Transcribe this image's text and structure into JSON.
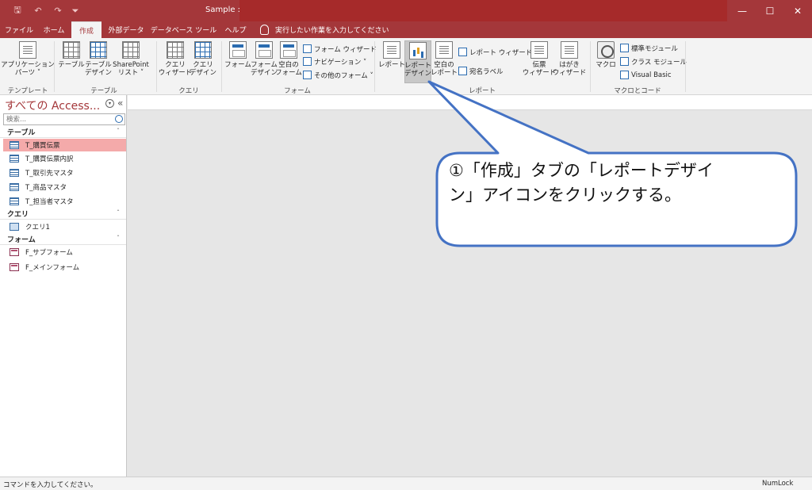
{
  "titlebar": {
    "title": "Sample :",
    "qat": {
      "save": "🖫",
      "undo": "↶",
      "redo": "↷",
      "customize": "⏷"
    },
    "window": {
      "minimize": "—",
      "maximize": "☐",
      "close": "✕"
    }
  },
  "tabs": [
    {
      "label": "ファイル"
    },
    {
      "label": "ホーム"
    },
    {
      "label": "作成"
    },
    {
      "label": "外部データ"
    },
    {
      "label": "データベース ツール"
    },
    {
      "label": "ヘルプ"
    }
  ],
  "tell_me": "実行したい作業を入力してください",
  "ribbon": {
    "groups": {
      "template": "テンプレート",
      "table": "テーブル",
      "query": "クエリ",
      "form": "フォーム",
      "report": "レポート",
      "macro": "マクロとコード"
    },
    "buttons": {
      "app_parts": "アプリケーション\nパーツ ˅",
      "table": "テーブル",
      "table_design": "テーブル\nデザイン",
      "sharepoint": "SharePoint\nリスト ˅",
      "query_wizard": "クエリ\nウィザード",
      "query_design": "クエリ\nデザイン",
      "form": "フォーム",
      "form_design": "フォーム\nデザイン",
      "blank_form": "空白の\nフォーム",
      "form_wizard": "フォーム ウィザード",
      "navigation": "ナビゲーション ˅",
      "more_forms": "その他のフォーム ˅",
      "report": "レポート",
      "report_design": "レポート\nデザイン",
      "blank_report": "空白の\nレポート",
      "report_wizard": "レポート ウィザード",
      "labels": "宛名ラベル",
      "slip_wizard": "伝票\nウィザード",
      "postcard_wizard": "はがき\nウィザード",
      "macro": "マクロ",
      "module": "標準モジュール",
      "class_module": "クラス モジュール",
      "visual_basic": "Visual Basic"
    }
  },
  "nav": {
    "title": "すべての Access...",
    "collapse": "«",
    "dropdown": "▾",
    "search_placeholder": "検索...",
    "sections": {
      "tables": {
        "label": "テーブル",
        "items": [
          "T_購買伝票",
          "T_購買伝票内訳",
          "T_取引先マスタ",
          "T_商品マスタ",
          "T_担当者マスタ"
        ]
      },
      "queries": {
        "label": "クエリ",
        "items": [
          "クエリ1"
        ]
      },
      "forms": {
        "label": "フォーム",
        "items": [
          "F_サブフォーム",
          "F_メインフォーム"
        ]
      }
    },
    "chevron": "ˆ"
  },
  "status": {
    "left": "コマンドを入力してください。",
    "right": "NumLock"
  },
  "callout": {
    "line1": "①「作成」タブの「レポートデザイ",
    "line2": "ン」アイコンをクリックする。"
  },
  "colors": {
    "accent": "#a4373a",
    "callout_border": "#4472c4",
    "selected_item": "#f4aaaa"
  }
}
